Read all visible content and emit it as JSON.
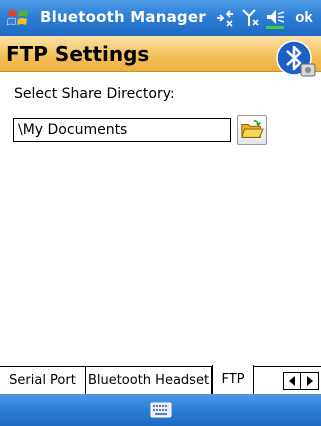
{
  "titlebar": {
    "app_title": "Bluetooth Manager",
    "ok_label": "ok",
    "icons": [
      "windows-start-icon",
      "connectivity-icon",
      "signal-icon",
      "volume-icon"
    ]
  },
  "header": {
    "title": "FTP Settings",
    "badge_icon": "bluetooth-icon"
  },
  "content": {
    "share_label": "Select Share Directory:",
    "directory_value": "\\My Documents",
    "browse_icon": "folder-open-icon"
  },
  "tabs": [
    {
      "label": "Serial Port",
      "selected": false
    },
    {
      "label": "Bluetooth Headset",
      "selected": false
    },
    {
      "label": "FTP",
      "selected": true
    }
  ],
  "menubar": {
    "icon": "keyboard-icon"
  },
  "colors": {
    "titlebar_blue": "#2f7fd6",
    "header_orange": "#f4c15a",
    "bluetooth_blue": "#1d5fc4"
  }
}
